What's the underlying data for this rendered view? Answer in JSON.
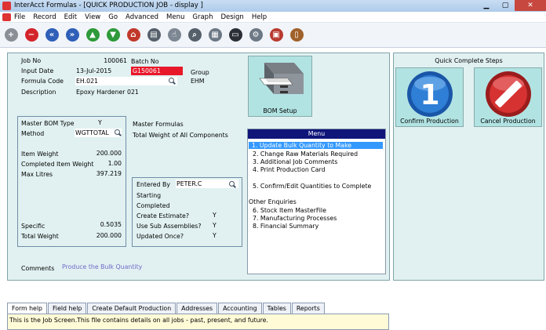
{
  "window": {
    "title": "InterAcct Formulas - [QUICK PRODUCTION JOB - display ]"
  },
  "menu": [
    "File",
    "Record",
    "Edit",
    "View",
    "Go",
    "Advanced",
    "Menu",
    "Graph",
    "Design",
    "Help"
  ],
  "toolbar": [
    {
      "icon": "add-icon",
      "glyph": "+",
      "color": "#8a8f96"
    },
    {
      "icon": "delete-icon",
      "glyph": "−",
      "color": "#d4242b"
    },
    {
      "icon": "first-record-icon",
      "glyph": "«",
      "color": "#2f5fb8"
    },
    {
      "icon": "last-record-icon",
      "glyph": "»",
      "color": "#2f5fb8"
    },
    {
      "icon": "previous-up-icon",
      "glyph": "▲",
      "color": "#2e9a3a"
    },
    {
      "icon": "next-down-icon",
      "glyph": "▼",
      "color": "#2e9a3a"
    },
    {
      "icon": "home-icon",
      "glyph": "⌂",
      "color": "#c0392b"
    },
    {
      "icon": "printer-icon",
      "glyph": "▤",
      "color": "#55606b"
    },
    {
      "icon": "pointer-icon",
      "glyph": "☝",
      "color": "#7d8793"
    },
    {
      "icon": "search-icon",
      "glyph": "⌕",
      "color": "#55606b"
    },
    {
      "icon": "table-icon",
      "glyph": "▦",
      "color": "#6c7885"
    },
    {
      "icon": "monitor-icon",
      "glyph": "▭",
      "color": "#2b2f36"
    },
    {
      "icon": "settings-gear-icon",
      "glyph": "⚙",
      "color": "#6c7885"
    },
    {
      "icon": "calendar-icon",
      "glyph": "▣",
      "color": "#b83a2e"
    },
    {
      "icon": "exit-door-icon",
      "glyph": "▯",
      "color": "#a0612a"
    }
  ],
  "form": {
    "job_no_label": "Job No",
    "job_no": "100061",
    "batch_no_label": "Batch No",
    "input_date_label": "Input Date",
    "input_date": "13-Jul-2015",
    "batch_no": "G150061",
    "group_label": "Group",
    "group_value": "EHM",
    "formula_code_label": "Formula Code",
    "formula_code": "EH.021",
    "description_label": "Description",
    "description": "Epoxy Hardener 021",
    "bom_setup_label": "BOM Setup",
    "master_bom_type_label": "Master BOM Type",
    "master_bom_type": "Y",
    "method_label": "Method",
    "method": "WGTTOTAL",
    "item_weight_label": "Item Weight",
    "item_weight": "200.000",
    "completed_item_weight_label": "Completed Item Weight",
    "completed_item_weight": "1.00",
    "max_litres_label": "Max Litres",
    "max_litres": "397.219",
    "specific_label": "Specific",
    "specific": "0.5035",
    "total_weight_label": "Total Weight",
    "total_weight": "200.000",
    "master_formulas_label": "Master Formulas",
    "total_weight_all_label": "Total Weight of All Components",
    "entered_by_label": "Entered By",
    "entered_by": "PETER.C",
    "starting_label": "Starting",
    "completed_label": "Completed",
    "create_estimate_label": "Create Estimate?",
    "create_estimate": "Y",
    "use_sub_assemblies_label": "Use Sub Assemblies?",
    "use_sub_assemblies": "Y",
    "updated_once_label": "Updated Once?",
    "updated_once": "Y",
    "comments_label": "Comments",
    "comments": "Produce the Bulk Quantity"
  },
  "job_menu": {
    "header": "Menu",
    "items": [
      "1. Update Bulk Quantity to Make",
      "2. Change Raw Materials Required",
      "3. Additional Job Comments",
      "4. Print Production Card",
      "5. Confirm/Edit Quantities to Complete",
      "Other Enquiries",
      "6. Stock Item MasterFile",
      "7. Manufacturing Processes",
      "8. Financial Summary"
    ]
  },
  "quick": {
    "title": "Quick Complete Steps",
    "confirm_label": "Confirm Production",
    "confirm_number": "1",
    "cancel_label": "Cancel Production"
  },
  "tabs": [
    "Form help",
    "Field help",
    "Create Default Production",
    "Addresses",
    "Accounting",
    "Tables",
    "Reports"
  ],
  "help_text": "This is the Job Screen.This file contains details on all jobs - past, present, and future."
}
